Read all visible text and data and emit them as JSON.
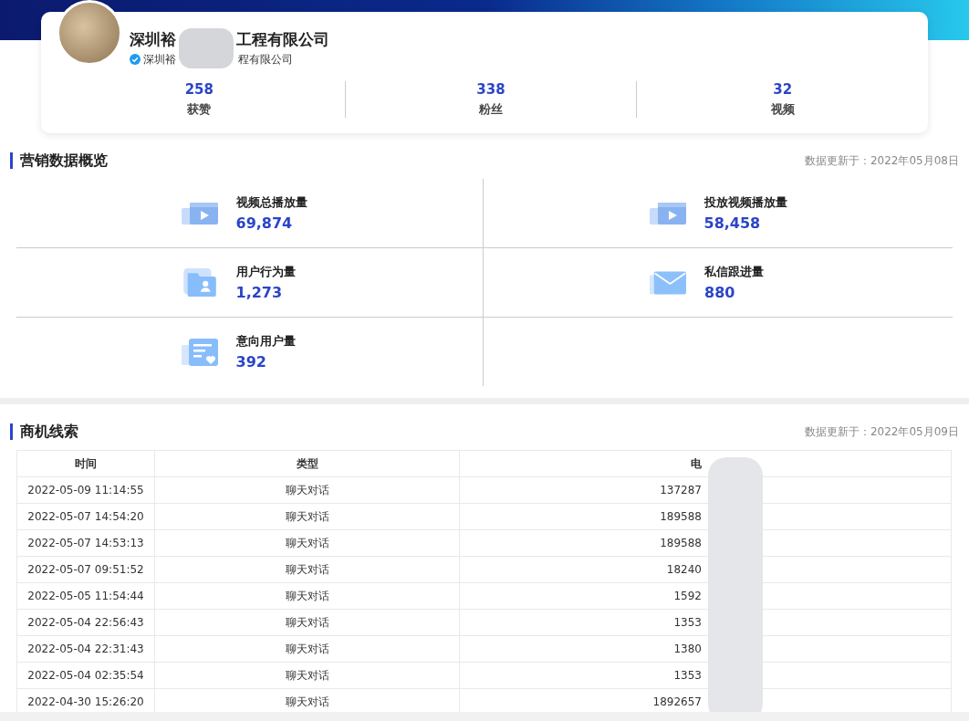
{
  "profile": {
    "name_start": "深圳裕",
    "name_end": "工程有限公司",
    "verified": true,
    "subtitle_start": "深圳裕",
    "subtitle_end": "程有限公司",
    "stats": [
      {
        "value": "258",
        "label": "获赞"
      },
      {
        "value": "338",
        "label": "粉丝"
      },
      {
        "value": "32",
        "label": "视频"
      }
    ]
  },
  "overview": {
    "title": "营销数据概览",
    "updated": "数据更新于：2022年05月08日",
    "metrics": [
      {
        "kind": "video",
        "label": "视频总播放量",
        "value": "69,874"
      },
      {
        "kind": "video",
        "label": "投放视频播放量",
        "value": "58,458"
      },
      {
        "kind": "folder",
        "label": "用户行为量",
        "value": "1,273"
      },
      {
        "kind": "mail",
        "label": "私信跟进量",
        "value": "880"
      },
      {
        "kind": "list",
        "label": "意向用户量",
        "value": "392"
      }
    ]
  },
  "leads": {
    "title": "商机线索",
    "updated": "数据更新于：2022年05月09日",
    "columns": [
      "时间",
      "类型",
      "电"
    ],
    "rows": [
      [
        "2022-05-09 11:14:55",
        "聊天对话",
        "137287"
      ],
      [
        "2022-05-07 14:54:20",
        "聊天对话",
        "189588"
      ],
      [
        "2022-05-07 14:53:13",
        "聊天对话",
        "189588"
      ],
      [
        "2022-05-07 09:51:52",
        "聊天对话",
        "18240"
      ],
      [
        "2022-05-05 11:54:44",
        "聊天对话",
        "1592"
      ],
      [
        "2022-05-04 22:56:43",
        "聊天对话",
        "1353"
      ],
      [
        "2022-05-04 22:31:43",
        "聊天对话",
        "1380"
      ],
      [
        "2022-05-04 02:35:54",
        "聊天对话",
        "1353"
      ],
      [
        "2022-04-30 15:26:20",
        "聊天对话",
        "1892657"
      ]
    ]
  }
}
